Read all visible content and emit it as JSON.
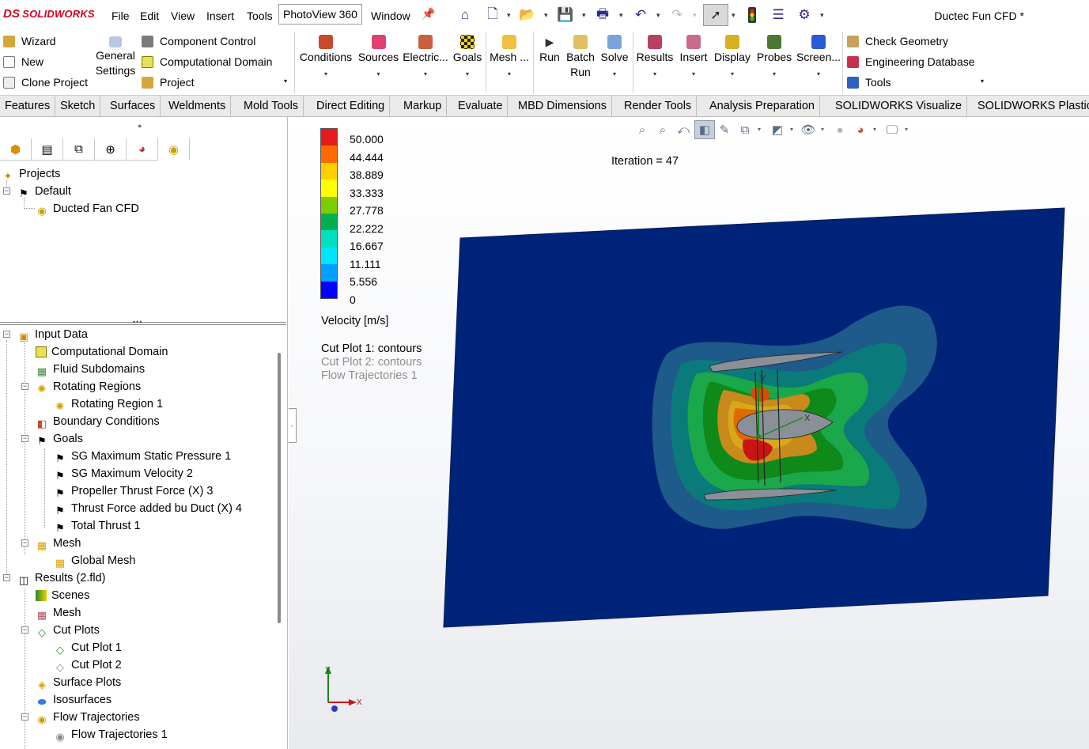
{
  "app": {
    "logo_mark": "DS",
    "logo_text": "SOLIDWORKS",
    "document_title": "Ductec Fun  CFD *"
  },
  "menu": [
    "File",
    "Edit",
    "View",
    "Insert",
    "Tools",
    "PhotoView 360",
    "Window"
  ],
  "quick_access_icons": [
    "home-icon",
    "new-document-icon",
    "open-icon",
    "save-icon",
    "print-icon",
    "undo-icon",
    "redo-icon",
    "select-arrow-icon",
    "traffic-light-icon",
    "file-properties-icon",
    "options-gear-icon"
  ],
  "command_manager": {
    "left_group": [
      {
        "label": "Wizard",
        "icon": "wizard-icon"
      },
      {
        "label": "New",
        "icon": "new-project-icon"
      },
      {
        "label": "Clone Project",
        "icon": "clone-project-icon"
      }
    ],
    "general_settings": {
      "line1": "General",
      "line2": "Settings"
    },
    "middle_group": [
      {
        "label": "Component Control",
        "icon": "component-control-icon"
      },
      {
        "label": "Computational Domain",
        "icon": "computational-domain-icon"
      },
      {
        "label": "Project",
        "icon": "project-icon"
      }
    ],
    "buttons": [
      {
        "label": "Conditions",
        "icon": "conditions-icon"
      },
      {
        "label": "Sources",
        "icon": "sources-icon"
      },
      {
        "label": "Electric...",
        "icon": "electric-icon"
      },
      {
        "label": "Goals",
        "icon": "goals-icon"
      },
      {
        "label": "Mesh ...",
        "icon": "mesh-icon"
      },
      {
        "label": "Run",
        "icon": "run-icon"
      },
      {
        "label": "Batch Run",
        "icon": "batch-run-icon"
      },
      {
        "label": "Solve",
        "icon": "solve-icon"
      },
      {
        "label": "Results",
        "icon": "results-icon"
      },
      {
        "label": "Insert",
        "icon": "insert-icon"
      },
      {
        "label": "Display",
        "icon": "display-icon"
      },
      {
        "label": "Probes",
        "icon": "probes-icon"
      },
      {
        "label": "Screen...",
        "icon": "screen-icon"
      }
    ],
    "right_group": [
      {
        "label": "Check Geometry",
        "icon": "check-geometry-icon"
      },
      {
        "label": "Engineering Database",
        "icon": "engineering-database-icon"
      },
      {
        "label": "Tools",
        "icon": "tools-icon"
      }
    ]
  },
  "tabs": [
    "Features",
    "Sketch",
    "Surfaces",
    "Weldments",
    "Mold Tools",
    "Direct Editing",
    "Markup",
    "Evaluate",
    "MBD Dimensions",
    "Render Tools",
    "Analysis Preparation",
    "SOLIDWORKS Visualize",
    "SOLIDWORKS Plastics"
  ],
  "left_panel": {
    "panel_tabs": [
      "feature-manager-icon",
      "property-manager-icon",
      "configuration-manager-icon",
      "dimxpert-icon",
      "display-manager-icon",
      "flow-simulation-icon"
    ],
    "projects": {
      "root": "Projects",
      "default": "Default",
      "project": "Ducted Fan CFD"
    },
    "tree": {
      "input_data": "Input Data",
      "computational_domain": "Computational Domain",
      "fluid_subdomains": "Fluid Subdomains",
      "rotating_regions": "Rotating Regions",
      "rotating_region_1": "Rotating Region 1",
      "boundary_conditions": "Boundary Conditions",
      "goals": "Goals",
      "goal_1": "SG Maximum Static Pressure 1",
      "goal_2": "SG Maximum Velocity 2",
      "goal_3": "Propeller Thrust Force (X) 3",
      "goal_4": "Thrust Force added bu Duct (X) 4",
      "goal_5": "Total Thrust 1",
      "mesh": "Mesh",
      "global_mesh": "Global Mesh",
      "results": "Results (2.fld)",
      "scenes": "Scenes",
      "results_mesh": "Mesh",
      "cut_plots": "Cut Plots",
      "cut_plot_1": "Cut Plot 1",
      "cut_plot_2": "Cut Plot 2",
      "surface_plots": "Surface Plots",
      "isosurfaces": "Isosurfaces",
      "flow_trajectories": "Flow Trajectories",
      "flow_trajectories_1": "Flow Trajectories 1"
    }
  },
  "viewport": {
    "hud_icons": [
      "zoom-to-fit-icon",
      "zoom-to-area-icon",
      "previous-view-icon",
      "section-view-icon",
      "dynamic-annotation-icon",
      "view-orientation-icon",
      "display-style-icon",
      "hide-show-items-icon",
      "edit-appearance-icon",
      "apply-scene-icon",
      "view-settings-icon"
    ],
    "iteration": "Iteration = 47",
    "legend": {
      "title": "Velocity [m/s]",
      "values": [
        "50.000",
        "44.444",
        "38.889",
        "33.333",
        "27.778",
        "22.222",
        "16.667",
        "11.111",
        "5.556",
        "0"
      ],
      "colors": [
        "#e41a1c",
        "#ff6a00",
        "#ffcf00",
        "#ffff00",
        "#7ccd00",
        "#00b050",
        "#00e0c0",
        "#00e5ff",
        "#00a0ff",
        "#0000ff"
      ]
    },
    "plot_labels": {
      "active": "Cut Plot 1: contours",
      "inactive_1": "Cut Plot 2: contours",
      "inactive_2": "Flow Trajectories 1"
    },
    "triad": {
      "y": "Y",
      "x": "X"
    },
    "model_axis": {
      "y": "Y",
      "x": "X"
    }
  }
}
